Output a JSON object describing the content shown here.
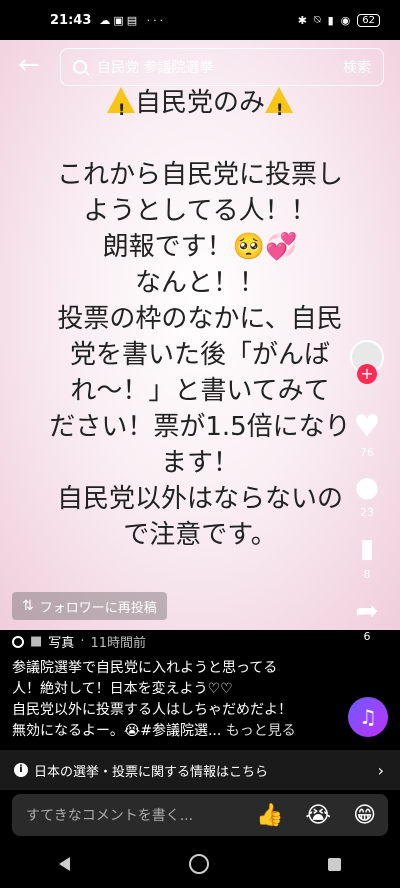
{
  "status": {
    "time": "21:43",
    "battery": "62"
  },
  "search": {
    "query": "自民党 参議院選挙",
    "button": "検索"
  },
  "post_lines": [
    "自民党のみ",
    "",
    "これから自民党に投票し",
    "ようとしてる人！！",
    "朗報です！🥺💞",
    "なんと！！",
    "投票の枠のなかに、自民",
    "党を書いた後「がんば",
    "れ〜！」と書いてみて",
    "ださい！票が1.5倍になり",
    "ます！",
    "自民党以外はならないの",
    "で注意です。"
  ],
  "repost": "フォロワーに再投稿",
  "counts": {
    "likes": "76",
    "comments": "23",
    "bookmarks": "8",
    "shares": "6"
  },
  "meta": {
    "type": "写真",
    "time": "11時間前"
  },
  "caption": "参議院選挙で自民党に入れようと思ってる\n人！絶対して！日本を変えよう♡♡\n自民党以外に投票する人はしちゃだめだよ！\n無効になるよー。😭#参議院選...",
  "more": "もっと見る",
  "info_bar": "日本の選挙・投票に関する情報はこちら",
  "comment_placeholder": "すてきなコメントを書く...",
  "emojis": [
    "👍",
    "😭",
    "😁"
  ],
  "icons": {
    "back": "arrow-left-icon",
    "search": "search-icon",
    "info": "info-icon"
  }
}
